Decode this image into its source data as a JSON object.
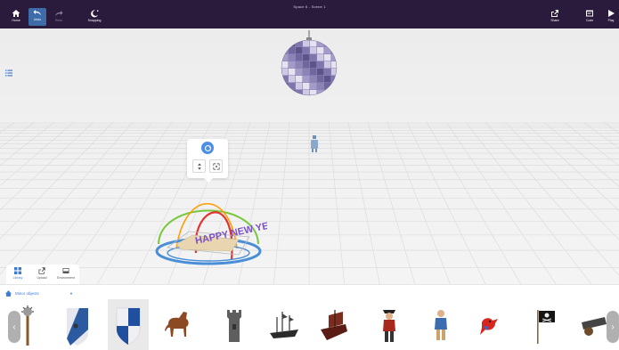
{
  "app": {
    "title": "Space 6 - Scene 1"
  },
  "toolbar": {
    "home_label": "Home",
    "undo_label": "Undo",
    "redo_label": "Redo",
    "snapping_label": "Snapping",
    "share_label": "Share",
    "code_label": "Code",
    "play_label": "Play"
  },
  "library": {
    "tabs": [
      {
        "label": "Library",
        "icon": "grid-icon",
        "active": true
      },
      {
        "label": "Upload",
        "icon": "upload-icon"
      },
      {
        "label": "Environment",
        "icon": "image-icon"
      }
    ],
    "category": "Minor objects",
    "items": [
      {
        "name": "mace",
        "icon": "mace-icon"
      },
      {
        "name": "white-blue shield",
        "icon": "shield-icon"
      },
      {
        "name": "blue shield",
        "icon": "shield-icon",
        "selected": true
      },
      {
        "name": "horse",
        "icon": "horse-icon"
      },
      {
        "name": "tower",
        "icon": "tower-icon"
      },
      {
        "name": "shipwreck",
        "icon": "ship-icon"
      },
      {
        "name": "pirate ship",
        "icon": "ship-icon"
      },
      {
        "name": "pirate captain",
        "icon": "pirate-icon"
      },
      {
        "name": "pirate",
        "icon": "pirate-icon"
      },
      {
        "name": "parrot",
        "icon": "parrot-icon"
      },
      {
        "name": "pirate flag",
        "icon": "flag-icon"
      },
      {
        "name": "cannon",
        "icon": "cannon-icon"
      }
    ]
  },
  "scene": {
    "object_text": "HAPPY NEW YEAR",
    "colors": {
      "accent": "#3d7ad6",
      "topbar": "#2a1a3c"
    }
  }
}
